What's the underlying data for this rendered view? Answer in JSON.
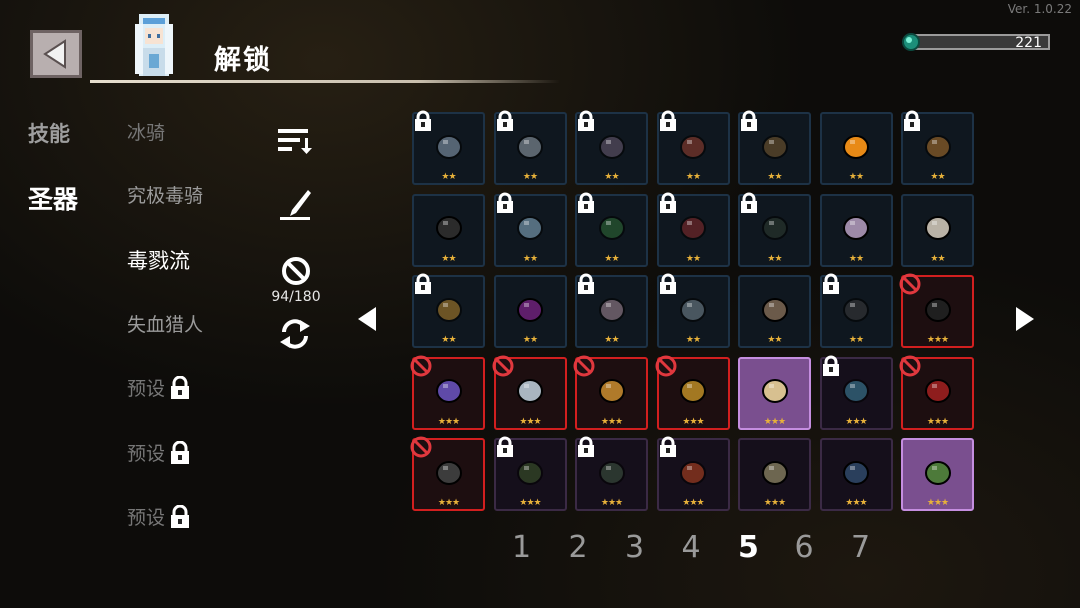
{
  "version": "Ver. 1.0.22",
  "header": {
    "title": "解锁",
    "currency": "221"
  },
  "tabs": [
    {
      "label": "技能",
      "active": false
    },
    {
      "label": "圣器",
      "active": true
    }
  ],
  "builds": [
    {
      "label": "冰骑",
      "locked": false,
      "active": false
    },
    {
      "label": "究极毒骑",
      "locked": false,
      "active": false
    },
    {
      "label": "毒戮流",
      "locked": false,
      "active": true
    },
    {
      "label": "失血猎人",
      "locked": false,
      "active": false
    },
    {
      "label": "预设",
      "locked": true,
      "active": false
    },
    {
      "label": "预设",
      "locked": true,
      "active": false
    },
    {
      "label": "预设",
      "locked": true,
      "active": false
    }
  ],
  "tools": {
    "sort_icon": "sort-icon",
    "pen_icon": "pen-icon",
    "ban_icon": "ban-filter-icon",
    "refresh_icon": "refresh-icon",
    "count": "94/180"
  },
  "grid": [
    [
      {
        "item": "flower",
        "stars": "★★",
        "state": "locked"
      },
      {
        "item": "chain",
        "stars": "★★",
        "state": "locked"
      },
      {
        "item": "crystal",
        "stars": "★★",
        "state": "locked"
      },
      {
        "item": "pot",
        "stars": "★★",
        "state": "locked"
      },
      {
        "item": "wheel",
        "stars": "★★",
        "state": "locked"
      },
      {
        "item": "orange",
        "stars": "★★",
        "state": "normal"
      },
      {
        "item": "moon-orb",
        "stars": "★★",
        "state": "locked"
      }
    ],
    [
      {
        "item": "black-glove",
        "stars": "★★",
        "state": "normal"
      },
      {
        "item": "ice-orb",
        "stars": "★★",
        "state": "locked"
      },
      {
        "item": "green-egg",
        "stars": "★★",
        "state": "locked"
      },
      {
        "item": "red-egg",
        "stars": "★★",
        "state": "locked"
      },
      {
        "item": "dark-blade",
        "stars": "★★",
        "state": "locked"
      },
      {
        "item": "amethyst",
        "stars": "★★",
        "state": "normal"
      },
      {
        "item": "letter",
        "stars": "★★",
        "state": "normal"
      }
    ],
    [
      {
        "item": "gold-ring",
        "stars": "★★",
        "state": "locked"
      },
      {
        "item": "void-eye",
        "stars": "★★",
        "state": "normal"
      },
      {
        "item": "pearl-shell",
        "stars": "★★",
        "state": "locked"
      },
      {
        "item": "feather",
        "stars": "★★",
        "state": "locked"
      },
      {
        "item": "bone-blade",
        "stars": "★★",
        "state": "normal"
      },
      {
        "item": "magnifier",
        "stars": "★★",
        "state": "locked"
      },
      {
        "item": "black-potion",
        "stars": "★★★",
        "state": "banned"
      }
    ],
    [
      {
        "item": "purple-bag",
        "stars": "★★★",
        "state": "banned"
      },
      {
        "item": "white-rock",
        "stars": "★★★",
        "state": "banned"
      },
      {
        "item": "dice",
        "stars": "★★★",
        "state": "banned"
      },
      {
        "item": "gold-cup",
        "stars": "★★★",
        "state": "banned"
      },
      {
        "item": "shell-gem",
        "stars": "★★★",
        "state": "selected"
      },
      {
        "item": "syringe",
        "stars": "★★★",
        "state": "locked"
      },
      {
        "item": "red-shield",
        "stars": "★★★",
        "state": "banned"
      }
    ],
    [
      {
        "item": "iron-cross",
        "stars": "★★★",
        "state": "banned"
      },
      {
        "item": "green-scroll",
        "stars": "★★★",
        "state": "locked"
      },
      {
        "item": "rocket-gun",
        "stars": "★★★",
        "state": "locked"
      },
      {
        "item": "fire-orb",
        "stars": "★★★",
        "state": "locked"
      },
      {
        "item": "map-scroll",
        "stars": "★★★",
        "state": "normal"
      },
      {
        "item": "spyglass",
        "stars": "★★★",
        "state": "normal"
      },
      {
        "item": "torch",
        "stars": "★★★",
        "state": "selected"
      }
    ]
  ],
  "pages": [
    "1",
    "2",
    "3",
    "4",
    "5",
    "6",
    "7"
  ],
  "current_page": "5",
  "colors": {
    "star": "#e7b13a",
    "ban_border": "#d21f1f",
    "selected_bg": "#7a4f8f",
    "normal_border": "#1d3246"
  }
}
